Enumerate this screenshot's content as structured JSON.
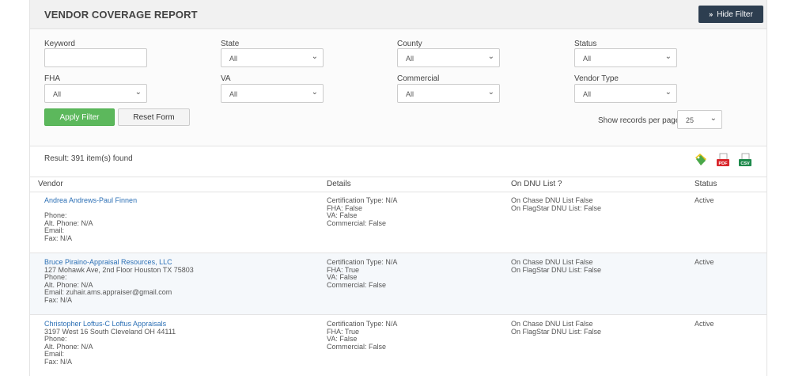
{
  "header": {
    "title": "VENDOR COVERAGE REPORT",
    "hide_filter_label": "Hide Filter"
  },
  "filters": {
    "keyword": {
      "label": "Keyword",
      "value": ""
    },
    "state": {
      "label": "State",
      "value": "All"
    },
    "county": {
      "label": "County",
      "value": "All"
    },
    "status": {
      "label": "Status",
      "value": "All"
    },
    "fha": {
      "label": "FHA",
      "value": "All"
    },
    "va": {
      "label": "VA",
      "value": "All"
    },
    "commercial": {
      "label": "Commercial",
      "value": "All"
    },
    "vendor_type": {
      "label": "Vendor Type",
      "value": "All"
    },
    "apply_label": "Apply Filter",
    "reset_label": "Reset Form",
    "records_label": "Show records per page",
    "records_value": "25"
  },
  "result_text": "Result: 391 item(s) found",
  "columns": {
    "vendor": "Vendor",
    "details": "Details",
    "dnu": "On DNU List ?",
    "status": "Status"
  },
  "rows": [
    {
      "name": "Andrea Andrews-Paul Finnen",
      "address": "",
      "phone": "Phone:",
      "alt_phone": "Alt. Phone: N/A",
      "email": "Email:",
      "fax": "Fax: N/A",
      "cert": "Certification Type: N/A",
      "fha": "FHA: False",
      "va": "VA: False",
      "commercial": "Commercial: False",
      "chase": "On Chase DNU List False",
      "flagstar": "On FlagStar DNU List: False",
      "status": "Active"
    },
    {
      "name": "Bruce Piraino-Appraisal Resources, LLC",
      "address": "127 Mohawk Ave, 2nd Floor Houston TX 75803",
      "phone": "Phone:",
      "alt_phone": "Alt. Phone: N/A",
      "email": "Email: zuhair.ams.appraiser@gmail.com",
      "fax": "Fax: N/A",
      "cert": "Certification Type: N/A",
      "fha": "FHA: True",
      "va": "VA: False",
      "commercial": "Commercial: False",
      "chase": "On Chase DNU List False",
      "flagstar": "On FlagStar DNU List: False",
      "status": "Active"
    },
    {
      "name": "Christopher Loftus-C Loftus Appraisals",
      "address": "3197 West 16 South Cleveland OH 44111",
      "phone": "Phone:",
      "alt_phone": "Alt. Phone: N/A",
      "email": "Email:",
      "fax": "Fax: N/A",
      "cert": "Certification Type: N/A",
      "fha": "FHA: True",
      "va": "VA: False",
      "commercial": "Commercial: False",
      "chase": "On Chase DNU List False",
      "flagstar": "On FlagStar DNU List: False",
      "status": "Active"
    }
  ],
  "export": {
    "tag_icon": "tag-icon",
    "pdf_icon": "pdf-export-icon",
    "pdf_text": "PDF",
    "csv_icon": "csv-export-icon",
    "csv_text": "CSV"
  },
  "colors": {
    "header_dark": "#2d3e50",
    "apply_green": "#5cb85c",
    "link_blue": "#2b6fb5",
    "pdf_red": "#d9262c",
    "csv_green": "#1e8a4c"
  }
}
